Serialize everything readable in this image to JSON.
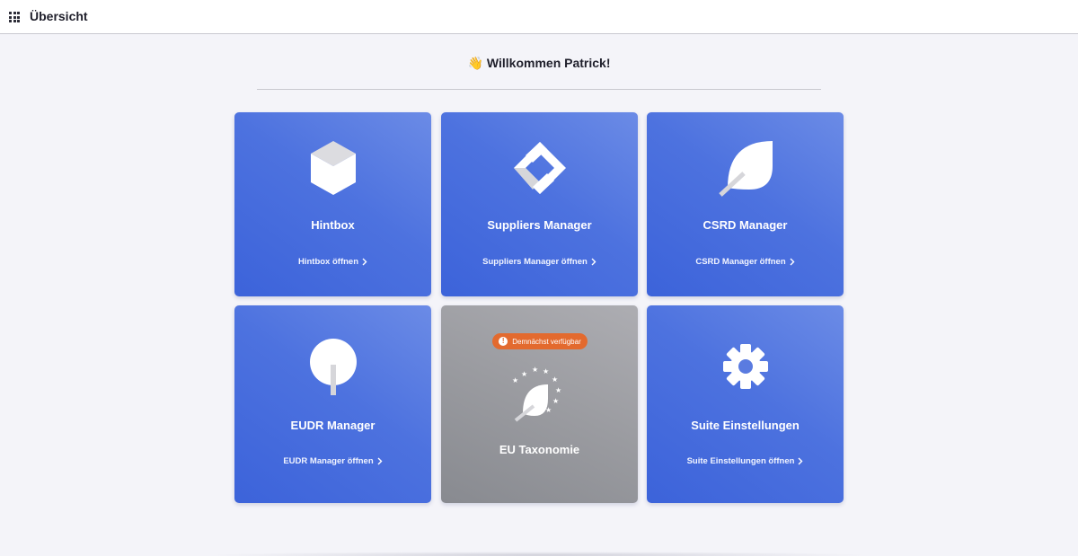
{
  "header": {
    "menu_icon": "grid-icon",
    "title": "Übersicht"
  },
  "welcome": {
    "emoji": "👋",
    "text": "Willkommen Patrick!"
  },
  "cards": [
    {
      "icon": "cube-icon",
      "title": "Hintbox",
      "link": "Hintbox öffnen"
    },
    {
      "icon": "diamond-frame-icon",
      "title": "Suppliers Manager",
      "link": "Suppliers Manager öffnen"
    },
    {
      "icon": "leaf-icon",
      "title": "CSRD Manager",
      "link": "CSRD Manager öffnen"
    },
    {
      "icon": "tree-icon",
      "title": "EUDR Manager",
      "link": "EUDR Manager öffnen"
    },
    {
      "icon": "eu-stars-leaf-icon",
      "title": "EU Taxonomie",
      "badge": "Demnächst verfügbar"
    },
    {
      "icon": "gear-icon",
      "title": "Suite Einstellungen",
      "link": "Suite Einstellungen öffnen"
    }
  ],
  "colors": {
    "card_gradient_start": "#6b8be6",
    "card_gradient_end": "#3c63da",
    "disabled_card": "#9a9ba0",
    "badge": "#e36a2e",
    "background": "#f4f4f9"
  }
}
